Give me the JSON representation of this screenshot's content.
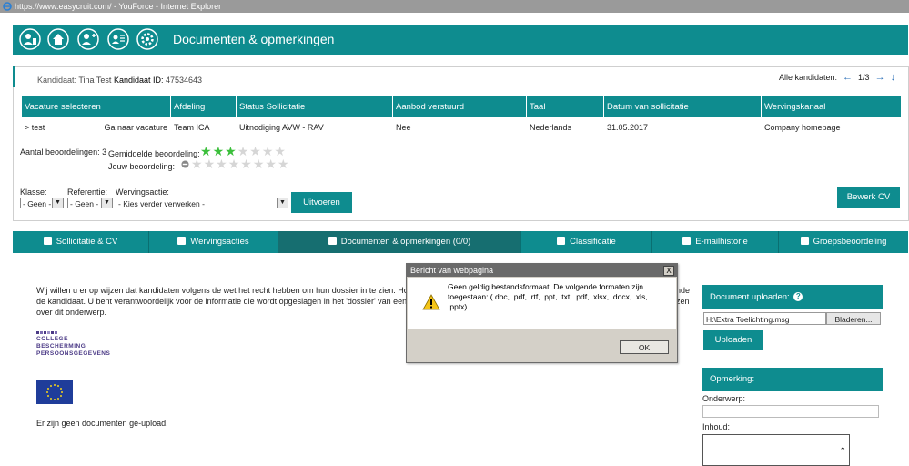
{
  "window": {
    "title": "https://www.easycruit.com/ - YouForce - Internet Explorer"
  },
  "header": {
    "title": "Documenten & opmerkingen",
    "icons": [
      "person-upload-icon",
      "home-icon",
      "add-person-icon",
      "list-person-icon",
      "settings-icon"
    ]
  },
  "candidate": {
    "label": "Kandidaat:",
    "name": "Tina Test",
    "id_label": "Kandidaat ID:",
    "id_value": "47534643",
    "nav_label": "Alle kandidaten:",
    "nav_position": "1/3"
  },
  "vacancy_table": {
    "headers": [
      "Vacature selecteren",
      "Afdeling",
      "Status Sollicitatie",
      "Aanbod verstuurd",
      "Taal",
      "Datum van sollicitatie",
      "Wervingskanaal"
    ],
    "row": {
      "vacancy": "> test",
      "goto": "Ga naar vacature",
      "department": "Team ICA",
      "status": "Uitnodiging AVW - RAV",
      "offer": "Nee",
      "language": "Nederlands",
      "date": "31.05.2017",
      "channel": "Company homepage"
    }
  },
  "ratings": {
    "count_label": "Aantal beoordelingen:",
    "count_value": "3",
    "avg_label": "Gemiddelde beoordeling:",
    "avg_stars": 3,
    "max_stars": 7,
    "own_label": "Jouw beoordeling:",
    "own_stars": 0
  },
  "actions": {
    "klasse_label": "Klasse:",
    "klasse_value": "- Geen -",
    "referentie_label": "Referentie:",
    "referentie_value": "- Geen -",
    "werving_label": "Wervingsactie:",
    "werving_value": "- Kies verder verwerken -",
    "execute": "Uitvoeren",
    "edit_cv": "Bewerk CV"
  },
  "tabs": [
    {
      "label": "Sollicitatie & CV",
      "icon": "shirt-icon"
    },
    {
      "label": "Wervingsacties",
      "icon": "document-icon"
    },
    {
      "label": "Documenten & opmerkingen (0/0)",
      "icon": "document-icon"
    },
    {
      "label": "Classificatie",
      "icon": "document-icon"
    },
    {
      "label": "E-mailhistorie",
      "icon": "document-icon"
    },
    {
      "label": "Groepsbeoordeling",
      "icon": "document-icon"
    }
  ],
  "content": {
    "line1": "Wij willen u er op wijzen dat kandidaten volgens de wet het recht hebben om hun dossier in te zien. Houd",
    "line1_end": "nde",
    "line2": "de kandidaat. U bent verantwoordelijk voor de informatie die wordt opgeslagen in het 'dossier' van een ka",
    "line2_end": "zen",
    "line3": "over dit onderwerp.",
    "cbp_line1": "COLLEGE",
    "cbp_line2": "BESCHERMING",
    "cbp_line3": "PERSOONSGEGEVENS",
    "no_docs": "Er zijn geen documenten ge-upload."
  },
  "upload": {
    "title": "Document uploaden:",
    "file_value": "H:\\Extra Toelichting.msg",
    "browse": "Bladeren...",
    "upload_button": "Uploaden"
  },
  "remark": {
    "title": "Opmerking:",
    "subject_label": "Onderwerp:",
    "content_label": "Inhoud:"
  },
  "dialog": {
    "title": "Bericht van webpagina",
    "message": "Geen geldig bestandsformaat. De volgende formaten zijn toegestaan: (.doc, .pdf, .rtf, .ppt, .txt, .pdf, .xlsx, .docx, .xls, .pptx)",
    "ok": "OK",
    "close": "X"
  },
  "colors": {
    "accent": "#0e8c8f",
    "star_green": "#3bbf3b"
  }
}
